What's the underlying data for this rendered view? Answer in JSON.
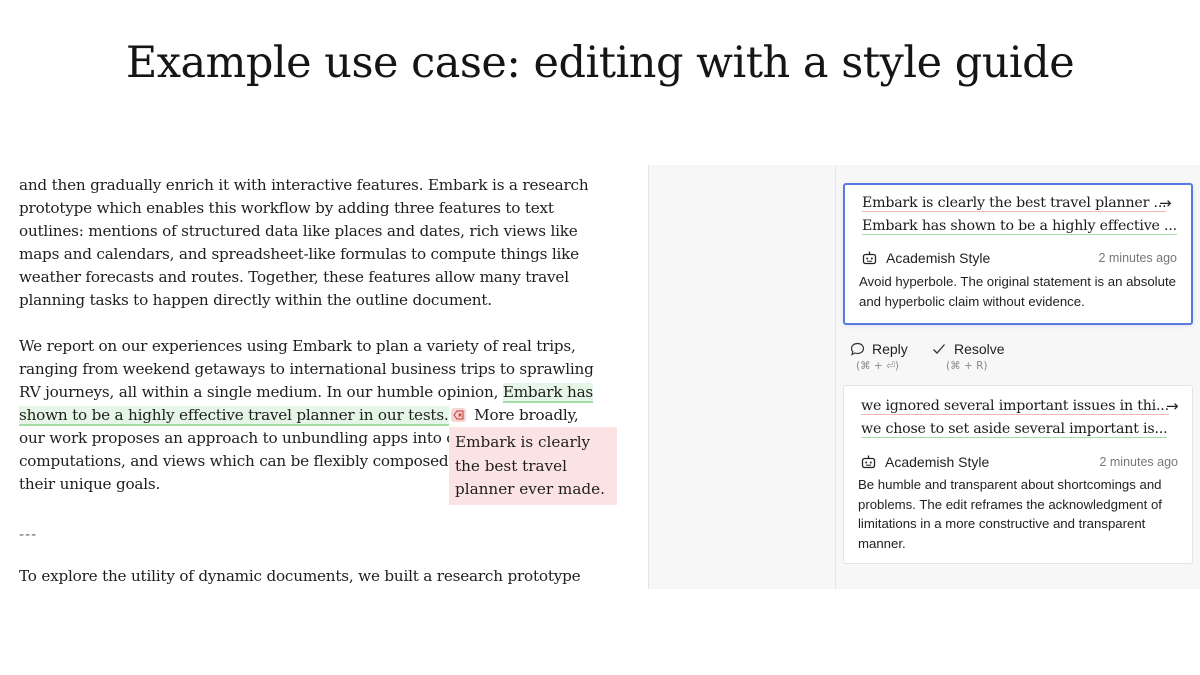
{
  "slide": {
    "title": "Example use case: editing with a style guide"
  },
  "document": {
    "para1": "and then gradually enrich it with interactive features. Embark is a research\nprototype which enables this workflow by adding three features to text\noutlines: mentions of structured data like places and dates, rich views like\nmaps and calendars, and spreadsheet-like formulas to compute things like\nweather forecasts and routes. Together, these features allow many travel\nplanning tasks to happen directly within the outline document.",
    "para2_a": "We report on our experiences using Embark to plan a variety of real trips,\nranging from weekend getaways to international business trips to sprawling\nRV journeys, all within a single medium. In our humble opinion, ",
    "para2_insert_1": "Embark has",
    "para2_insert_2": "shown to be a highly effective travel planner in our tests.",
    "para2_b": " More broadly,",
    "para2_c": "our work proposes an approach to unbundling apps into c\ncomputations, and views which can be flexibly composed\ntheir unique goals.",
    "deleted_text": "Embark is clearly the best travel planner ever made.",
    "separator": "---",
    "para3": "To explore the utility of dynamic documents, we built a research prototype"
  },
  "comments": [
    {
      "old_text": "Embark is clearly the best travel planner ...",
      "new_text": "Embark has shown to be a highly effective ...",
      "author": "Academish Style",
      "time": "2 minutes ago",
      "explanation": "Avoid hyperbole. The original statement is an absolute and hyperbolic claim without evidence."
    },
    {
      "old_text": "we ignored several important issues in thi...",
      "new_text": "we chose to set aside several important is...",
      "author": "Academish Style",
      "time": "2 minutes ago",
      "explanation": "Be humble and transparent about shortcomings and problems. The edit reframes the acknowledgment of limitations in a more constructive and transparent manner."
    }
  ],
  "actions": {
    "reply_label": "Reply",
    "reply_shortcut": "(⌘ + ⏎)",
    "resolve_label": "Resolve",
    "resolve_shortcut": "(⌘ + R)"
  },
  "colors": {
    "insert_bg": "#e6f6e6",
    "delete_bg": "#fbe3e3",
    "active_border": "#5b7bdc"
  }
}
